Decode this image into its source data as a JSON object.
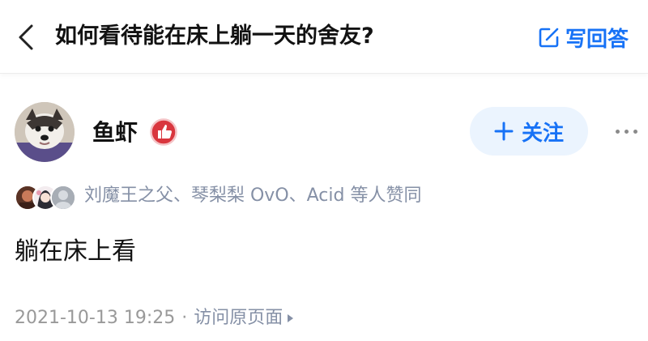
{
  "header": {
    "back_icon": "chevron-left-icon",
    "question_title": "如何看待能在床上躺一天的舍友?",
    "write_answer_icon": "edit-icon",
    "write_answer_label": "写回答"
  },
  "author": {
    "name": "鱼虾",
    "badge_icon": "thumbs-up-badge-icon",
    "follow_label": "关注",
    "follow_icon": "plus-icon",
    "more_icon": "more-dots-icon"
  },
  "approval": {
    "text": "刘魔王之父、琴梨梨 OvO、Acid 等人赞同"
  },
  "answer": {
    "content": "躺在床上看"
  },
  "meta": {
    "datetime": "2021-10-13 19:25",
    "separator": "·",
    "view_original_label": "访问原页面"
  },
  "colors": {
    "accent": "#1772f6",
    "follow_bg": "#ebf4fe",
    "secondary_text": "#8590a6",
    "badge_red": "#d9363e"
  }
}
